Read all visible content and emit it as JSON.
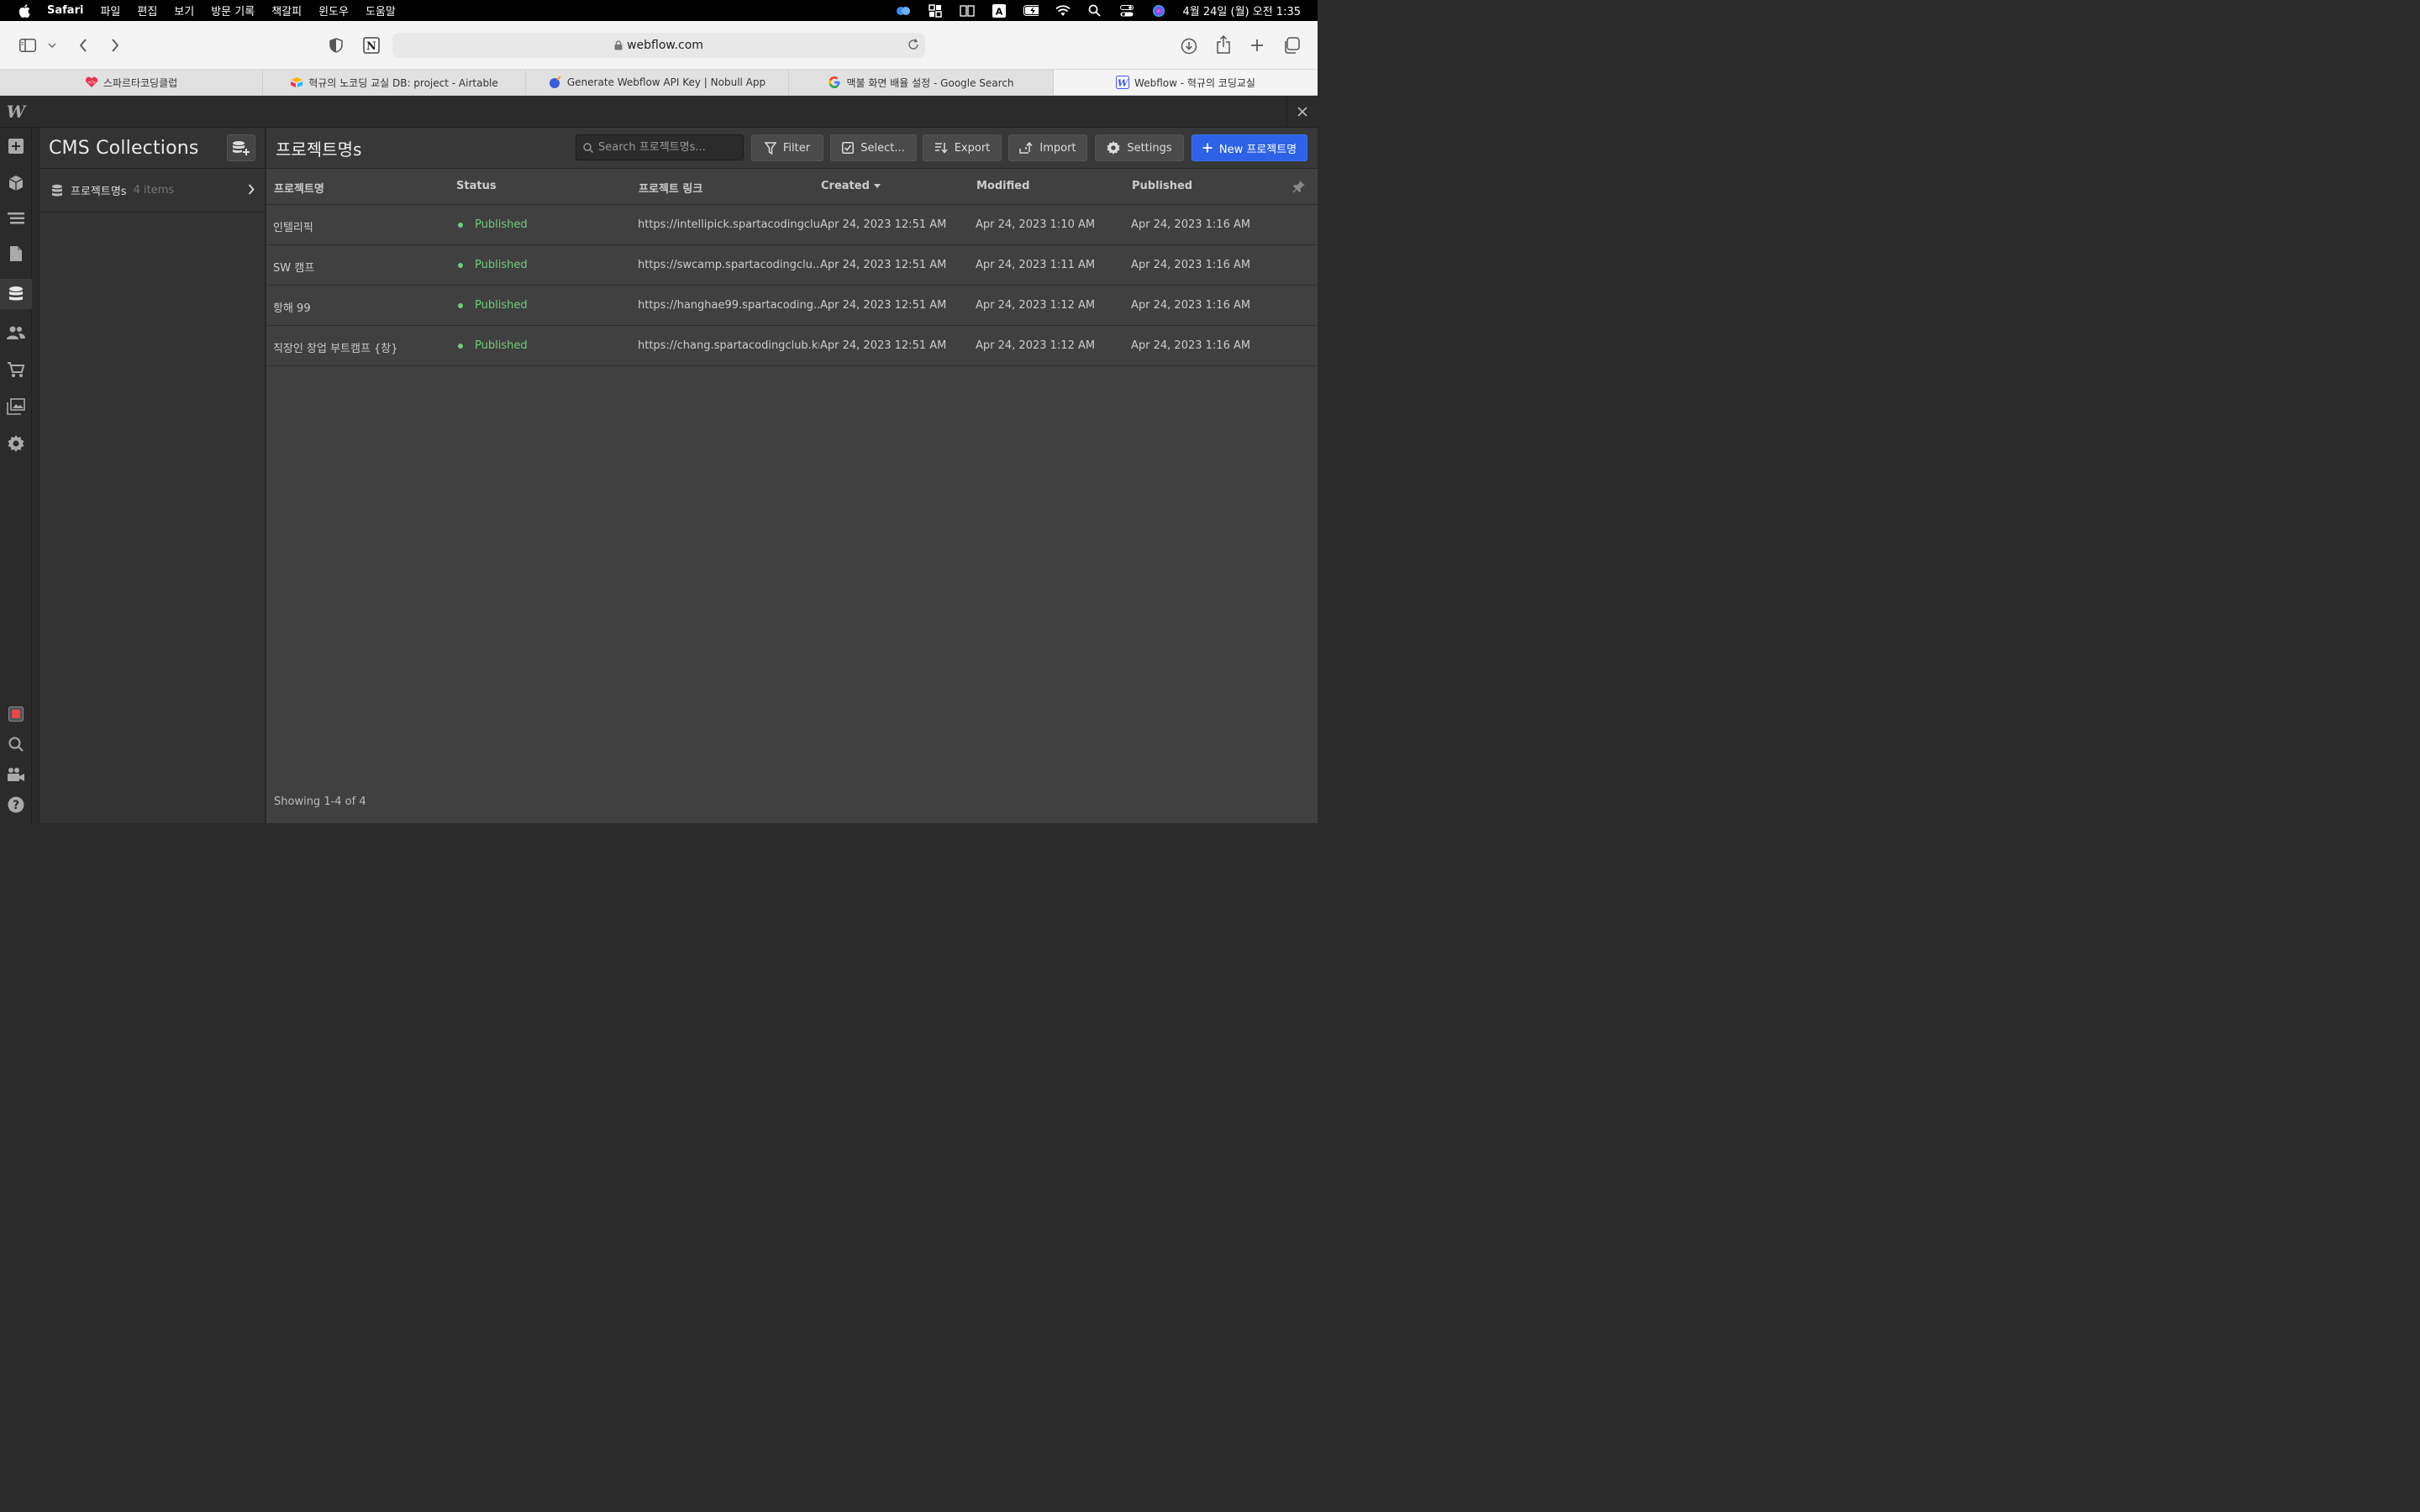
{
  "menubar": {
    "app": "Safari",
    "items": [
      "파일",
      "편집",
      "보기",
      "방문 기록",
      "책갈피",
      "윈도우",
      "도움말"
    ],
    "clock": "4월 24일 (월) 오전 1:35"
  },
  "browser": {
    "url": "webflow.com",
    "tabs": [
      {
        "label": "스파르타코딩클럽"
      },
      {
        "label": "혁규의 노코딩 교실 DB: project - Airtable"
      },
      {
        "label": "Generate Webflow API Key | Nobull App"
      },
      {
        "label": "맥불 화면 배율 설정 - Google Search"
      },
      {
        "label": "Webflow - 혁규의 코딩교실"
      }
    ]
  },
  "webflow": {
    "logo": "W",
    "collections_panel": {
      "title": "CMS Collections",
      "items": [
        {
          "name": "프로젝트명s",
          "count": "4 items"
        }
      ]
    },
    "collection": {
      "title": "프로젝트명s",
      "search_placeholder": "Search 프로젝트명s...",
      "buttons": {
        "filter": "Filter",
        "select": "Select...",
        "export": "Export",
        "import": "Import",
        "settings": "Settings",
        "new": "New 프로젝트명"
      },
      "columns": {
        "name": "프로젝트명",
        "status": "Status",
        "link": "프로젝트 링크",
        "created": "Created",
        "modified": "Modified",
        "published": "Published"
      },
      "rows": [
        {
          "name": "인텔리픽",
          "status": "Published",
          "link": "https://intellipick.spartacodingclu...",
          "created": "Apr 24, 2023 12:51 AM",
          "modified": "Apr 24, 2023 1:10 AM",
          "published": "Apr 24, 2023 1:16 AM"
        },
        {
          "name": "SW 캠프",
          "status": "Published",
          "link": "https://swcamp.spartacodingclu...",
          "created": "Apr 24, 2023 12:51 AM",
          "modified": "Apr 24, 2023 1:11 AM",
          "published": "Apr 24, 2023 1:16 AM"
        },
        {
          "name": "항해 99",
          "status": "Published",
          "link": "https://hanghae99.spartacoding...",
          "created": "Apr 24, 2023 12:51 AM",
          "modified": "Apr 24, 2023 1:12 AM",
          "published": "Apr 24, 2023 1:16 AM"
        },
        {
          "name": "직장인 창업 부트캠프 {창}",
          "status": "Published",
          "link": "https://chang.spartacodingclub.kr/",
          "created": "Apr 24, 2023 12:51 AM",
          "modified": "Apr 24, 2023 1:12 AM",
          "published": "Apr 24, 2023 1:16 AM"
        }
      ],
      "footer": "Showing 1-4 of 4"
    }
  },
  "colors": {
    "accent": "#2d62e6",
    "published": "#6ece79"
  }
}
